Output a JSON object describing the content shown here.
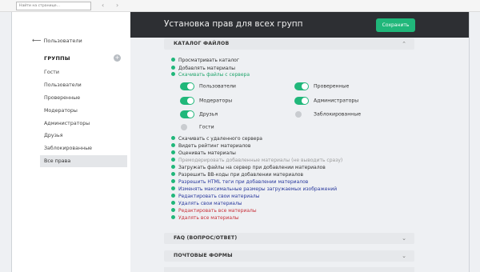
{
  "browser": {
    "search_placeholder": "Найти на странице...",
    "back_glyph": "‹",
    "forward_glyph": "›"
  },
  "sidebar": {
    "back_label": "Пользователи",
    "groups_title": "ГРУППЫ",
    "add_glyph": "+",
    "items": [
      {
        "label": "Гости"
      },
      {
        "label": "Пользователи"
      },
      {
        "label": "Проверенные"
      },
      {
        "label": "Модераторы"
      },
      {
        "label": "Администраторы"
      },
      {
        "label": "Друзья"
      },
      {
        "label": "Заблокированные"
      },
      {
        "label": "Все права"
      }
    ]
  },
  "header": {
    "title": "Установка прав для всех групп",
    "save_label": "Сохранить"
  },
  "sections": [
    {
      "title": "КАТАЛОГ ФАЙЛОВ",
      "chevron": "⌃"
    },
    {
      "title": "FAQ (ВОПРОС/ОТВЕТ)",
      "chevron": "⌄"
    },
    {
      "title": "ПОЧТОВЫЕ ФОРМЫ",
      "chevron": "⌄"
    }
  ],
  "permissions_top": [
    {
      "label": "Просматривать каталог",
      "style": "normal"
    },
    {
      "label": "Добавлять материалы",
      "style": "normal"
    },
    {
      "label": "Скачивать файлы с сервера",
      "style": "green"
    }
  ],
  "group_toggles": [
    {
      "label": "Пользователи",
      "on": true
    },
    {
      "label": "Проверенные",
      "on": true
    },
    {
      "label": "Модераторы",
      "on": true
    },
    {
      "label": "Администраторы",
      "on": true
    },
    {
      "label": "Друзья",
      "on": true
    },
    {
      "label": "Заблокированные",
      "on": false
    },
    {
      "label": "Гости",
      "on": false
    }
  ],
  "permissions_bottom": [
    {
      "label": "Скачивать с удаленного сервера",
      "style": "normal"
    },
    {
      "label": "Видеть рейтинг материалов",
      "style": "normal"
    },
    {
      "label": "Оценивать материалы",
      "style": "normal"
    },
    {
      "label": "Премодерировать добавленные материалы (не выводить сразу)",
      "style": "grey"
    },
    {
      "label": "Загружать файлы на сервер при добавлении материалов",
      "style": "normal"
    },
    {
      "label": "Разрешить BB-коды при добавлении материалов",
      "style": "normal"
    },
    {
      "label": "Разрешить HTML теги при добавлении материалов",
      "style": "blue"
    },
    {
      "label": "Изменять максимальные размеры загружаемых изображений",
      "style": "blue"
    },
    {
      "label": "Редактировать свои материалы",
      "style": "blue"
    },
    {
      "label": "Удалять свои материалы",
      "style": "blue"
    },
    {
      "label": "Редактировать все материалы",
      "style": "red"
    },
    {
      "label": "Удалять все материалы",
      "style": "red"
    }
  ],
  "colors": {
    "accent": "#20b77a",
    "header_bg": "#2d2f33",
    "blue_text": "#2a3a9e",
    "red_text": "#c8313a",
    "section_bg": "#e6e8eb"
  }
}
